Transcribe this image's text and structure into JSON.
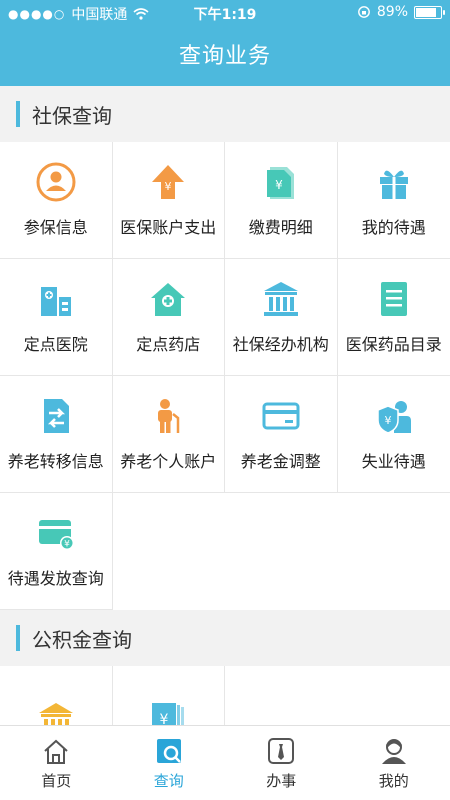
{
  "status_bar": {
    "carrier": "中国联通",
    "time": "下午1:19",
    "battery": "89%",
    "battery_level": 0.89
  },
  "header": {
    "title": "查询业务"
  },
  "sections": [
    {
      "title": "社保查询",
      "items": [
        {
          "label": "参保信息",
          "icon": "person-circle-icon",
          "color": "#f39a45"
        },
        {
          "label": "医保账户支出",
          "icon": "arrow-up-yen-icon",
          "color": "#f39a45"
        },
        {
          "label": "缴费明细",
          "icon": "yen-document-icon",
          "color": "#47c8b7"
        },
        {
          "label": "我的待遇",
          "icon": "gift-icon",
          "color": "#4db9dd"
        },
        {
          "label": "定点医院",
          "icon": "hospital-icon",
          "color": "#4db9dd"
        },
        {
          "label": "定点药店",
          "icon": "pharmacy-house-icon",
          "color": "#47c8b7"
        },
        {
          "label": "社保经办机构",
          "icon": "institution-building-icon",
          "color": "#4db9dd"
        },
        {
          "label": "医保药品目录",
          "icon": "list-document-icon",
          "color": "#47c8b7"
        },
        {
          "label": "养老转移信息",
          "icon": "transfer-document-icon",
          "color": "#4db9dd"
        },
        {
          "label": "养老个人账户",
          "icon": "elderly-person-icon",
          "color": "#f39a45"
        },
        {
          "label": "养老金调整",
          "icon": "card-icon",
          "color": "#4db9dd"
        },
        {
          "label": "失业待遇",
          "icon": "shield-person-icon",
          "color": "#4db9dd"
        },
        {
          "label": "待遇发放查询",
          "icon": "card-yen-icon",
          "color": "#47c8b7"
        }
      ]
    },
    {
      "title": "公积金查询",
      "items": [
        {
          "label": "",
          "icon": "bank-icon",
          "color": "#f3b636"
        },
        {
          "label": "",
          "icon": "yen-books-icon",
          "color": "#4db9dd"
        }
      ]
    }
  ],
  "tabbar": [
    {
      "label": "首页",
      "icon": "home-icon",
      "active": false
    },
    {
      "label": "查询",
      "icon": "search-icon",
      "active": true
    },
    {
      "label": "办事",
      "icon": "tie-icon",
      "active": false
    },
    {
      "label": "我的",
      "icon": "user-icon",
      "active": false
    }
  ],
  "colors": {
    "primary": "#4db9dd",
    "orange": "#f39a45",
    "teal": "#47c8b7"
  }
}
